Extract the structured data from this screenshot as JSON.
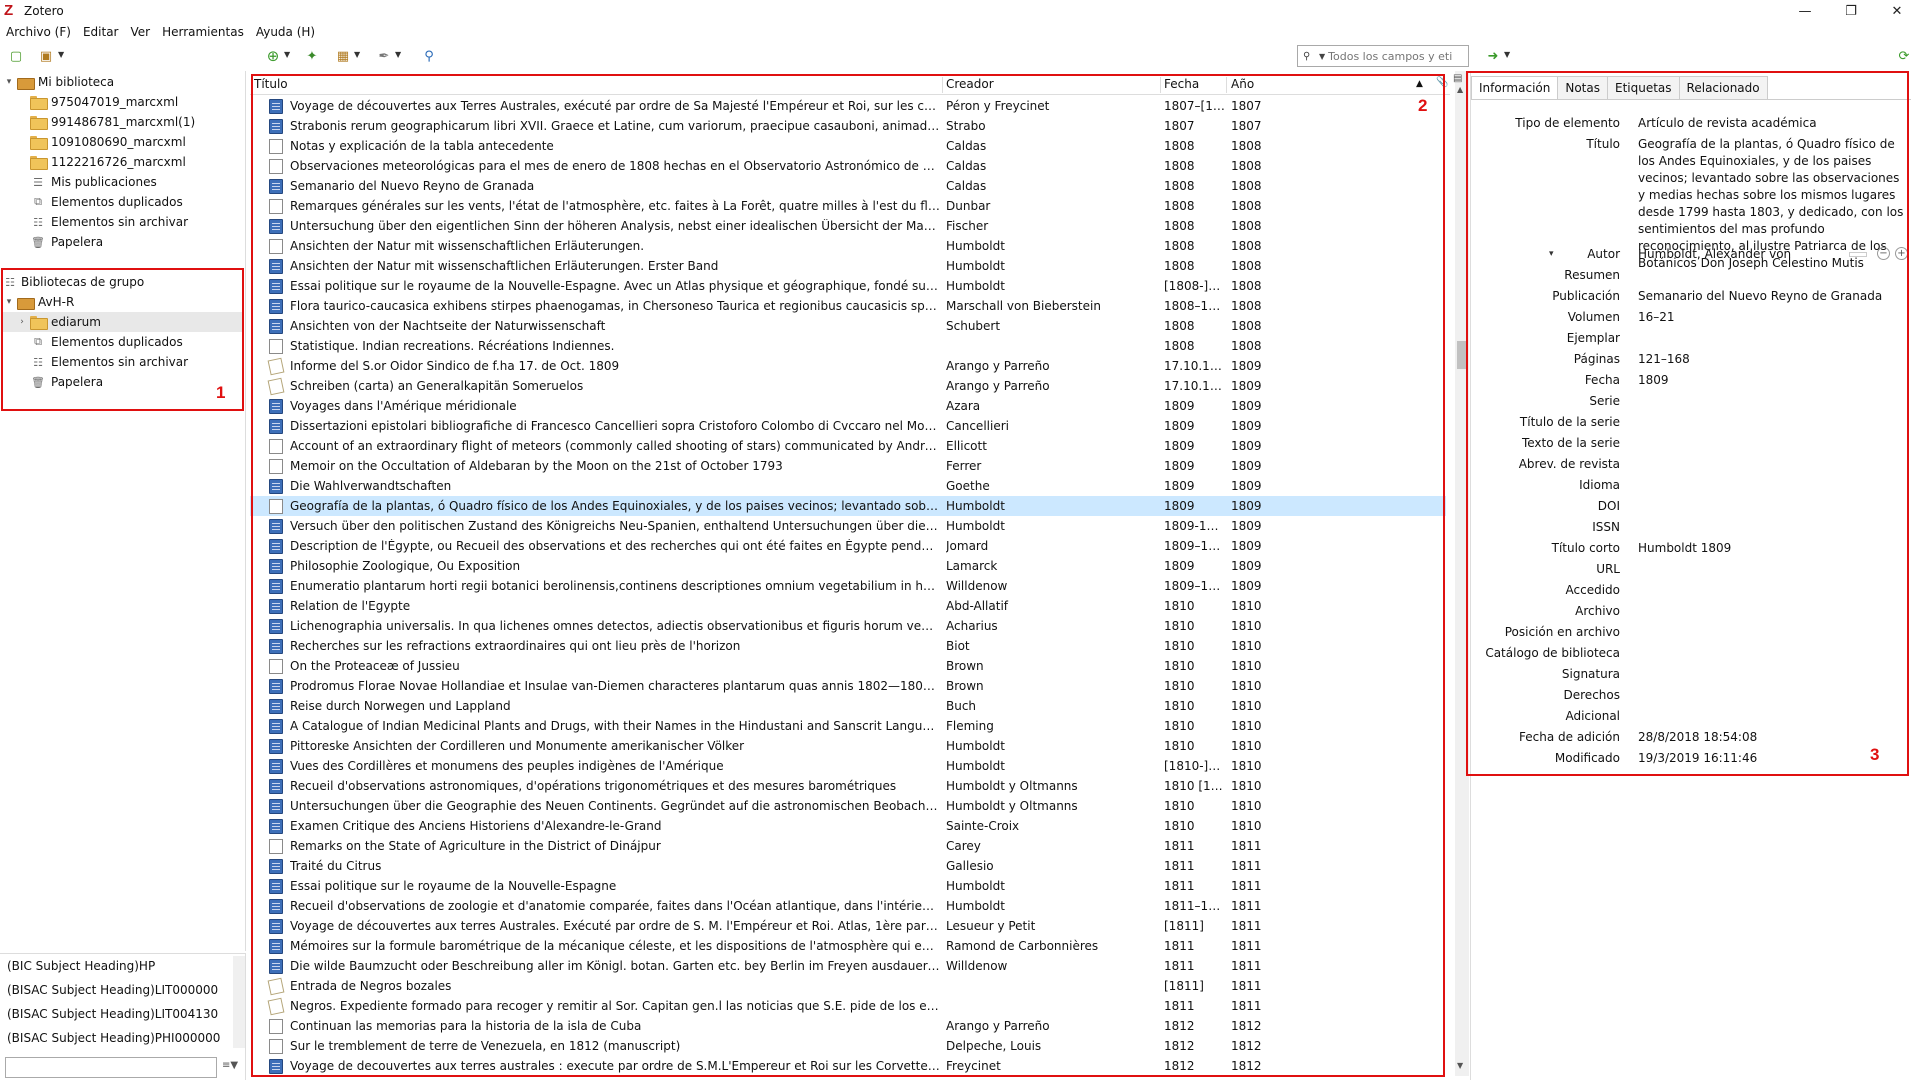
{
  "window": {
    "title": "Zotero"
  },
  "menu": [
    "Archivo (F)",
    "Editar",
    "Ver",
    "Herramientas",
    "Ayuda (H)"
  ],
  "search": {
    "placeholder": "Todos los campos y eti"
  },
  "collections": {
    "my_library": "Mi biblioteca",
    "my_library_items": [
      "975047019_marcxml",
      "991486781_marcxml(1)",
      "1091080690_marcxml",
      "1122216726_marcxml"
    ],
    "my_publications": "Mis publicaciones",
    "duplicates": "Elementos duplicados",
    "unfiled": "Elementos sin archivar",
    "trash": "Papelera",
    "group_libraries": "Bibliotecas de grupo",
    "group_name": "AvH-R",
    "group_collection": "ediarum",
    "group_duplicates": "Elementos duplicados",
    "group_unfiled": "Elementos sin archivar",
    "group_trash": "Papelera"
  },
  "tags": [
    "(BIC Subject Heading)HP",
    "(BISAC Subject Heading)LIT000000",
    "(BISAC Subject Heading)LIT004130",
    "(BISAC Subject Heading)PHI000000"
  ],
  "items_columns": {
    "title": "Título",
    "creator": "Creador",
    "date": "Fecha",
    "year": "Año"
  },
  "items": [
    {
      "type": "journal",
      "title": "Voyage de découvertes aux Terres Australes, exécuté par ordre de Sa Majesté l'Empéreur et Roi, sur les corvettes le Géogra...",
      "creator": "Péron y Freycinet",
      "date": "1807–[181...",
      "year": "1807"
    },
    {
      "type": "journal",
      "title": "Strabonis rerum geographicarum libri XVII. Graece et Latine, cum variorum, praecipue casaubonі, animadversionibus, juxt...",
      "creator": "Strabo",
      "date": "1807",
      "year": "1807"
    },
    {
      "type": "doc",
      "title": "Notas y explicación de la tabla antecedente",
      "creator": "Caldas",
      "date": "1808",
      "year": "1808"
    },
    {
      "type": "doc",
      "title": "Observaciones meteorológicas para el mes de enero de 1808 hechas en el Observatorio Astronómico de Santafé de Bogot...",
      "creator": "Caldas",
      "date": "1808",
      "year": "1808"
    },
    {
      "type": "journal",
      "title": "Semanario del Nuevo Reyno de Granada",
      "creator": "Caldas",
      "date": "1808",
      "year": "1808"
    },
    {
      "type": "doc",
      "title": "Remarques générales sur les vents, l'état de l'atmosphère, etc. faites à La Forêt, quatre milles à l'est du fleuve Mississipi ...",
      "creator": "Dunbar",
      "date": "1808",
      "year": "1808"
    },
    {
      "type": "journal",
      "title": "Untersuchung über den eigentlichen Sinn der höheren Analysis, nebst einer idealischen Übersicht der Mathematik und Na...",
      "creator": "Fischer",
      "date": "1808",
      "year": "1808"
    },
    {
      "type": "doc",
      "title": "Ansichten der Natur mit wissenschaftlichen Erläuterungen.",
      "creator": "Humboldt",
      "date": "1808",
      "year": "1808"
    },
    {
      "type": "journal",
      "title": "Ansichten der Natur mit wissenschaftlichen Erläuterungen. Erster Band",
      "creator": "Humboldt",
      "date": "1808",
      "year": "1808"
    },
    {
      "type": "journal",
      "title": "Essai politique sur le royaume de la Nouvelle-Espagne. Avec un Atlas physique et géographique, fondé sur des observatio...",
      "creator": "Humboldt",
      "date": "[1808-]1811",
      "year": "1808"
    },
    {
      "type": "journal",
      "title": "Flora taurico-caucasica exhibens stirpes phaenogamas, in Chersoneso Taurica et regionibus caucasicis sponte crescentes",
      "creator": "Marschall von Bieberstein",
      "date": "1808–1819",
      "year": "1808"
    },
    {
      "type": "journal",
      "title": "Ansichten von der Nachtseite der Naturwissenschaft",
      "creator": "Schubert",
      "date": "1808",
      "year": "1808"
    },
    {
      "type": "doc",
      "title": "Statistique. Indian recreations. Récréations Indiennes.",
      "creator": "",
      "date": "1808",
      "year": "1808"
    },
    {
      "type": "manuscript",
      "title": "Informe del S.or Oidor Sindico de f.ha 17. de Oct. 1809",
      "creator": "Arango y Parreño",
      "date": "17.10.1809",
      "year": "1809"
    },
    {
      "type": "manuscript",
      "title": "Schreiben (carta) an Generalkapitän Someruelos",
      "creator": "Arango y Parreño",
      "date": "17.10.1809",
      "year": "1809"
    },
    {
      "type": "journal",
      "title": "Voyages dans l'Amérique méridionale",
      "creator": "Azara",
      "date": "1809",
      "year": "1809"
    },
    {
      "type": "journal",
      "title": "Dissertazioni epistolari bibliografiche di Francesco Cancellieri sopra Cristoforo Colombo di Cvccaro nel Monferrato, disco...",
      "creator": "Cancellieri",
      "date": "1809",
      "year": "1809"
    },
    {
      "type": "doc",
      "title": "Account of an extraordinary flight of meteors (commonly called shooting of stars) communicated by Andrew Ellicot, Esq....",
      "creator": "Ellicott",
      "date": "1809",
      "year": "1809"
    },
    {
      "type": "doc",
      "title": "Memoir on the Occultation of Aldebaran by the Moon on the 21st of October 1793",
      "creator": "Ferrer",
      "date": "1809",
      "year": "1809"
    },
    {
      "type": "journal",
      "title": "Die Wahlverwandtschaften",
      "creator": "Goethe",
      "date": "1809",
      "year": "1809"
    },
    {
      "type": "doc",
      "title": "Geografía de la plantas, ó Quadro físico de los Andes Equinoxiales, y de los paises vecinos; levantado sobre las observacio...",
      "creator": "Humboldt",
      "date": "1809",
      "year": "1809",
      "selected": true
    },
    {
      "type": "journal",
      "title": "Versuch über den politischen Zustand des Königreichs Neu-Spanien, enthaltend Untersuchungen über die Geographie de...",
      "creator": "Humboldt",
      "date": "1809-1814",
      "year": "1809"
    },
    {
      "type": "journal",
      "title": "Description de l'Égypte, ou Recueil des observations et des recherches qui ont été faites en Égypte pendant l'expédition d...",
      "creator": "Jomard",
      "date": "1809–1818",
      "year": "1809"
    },
    {
      "type": "journal",
      "title": "Philosophie Zoologique, Ou Exposition",
      "creator": "Lamarck",
      "date": "1809",
      "year": "1809"
    },
    {
      "type": "journal",
      "title": "Enumeratio plantarum horti regii botanici berolinensis,continens descriptiones omnium vegetabilium in horto dicto culto...",
      "creator": "Willdenow",
      "date": "1809–1813",
      "year": "1809"
    },
    {
      "type": "journal",
      "title": "Relation de l'Egypte",
      "creator": "Abd-Allatif",
      "date": "1810",
      "year": "1810"
    },
    {
      "type": "journal",
      "title": "Lichenographia universalis. In qua lichenes omnes detectos, adiectis observationibus et figuris horum vegetabilium natur...",
      "creator": "Acharius",
      "date": "1810",
      "year": "1810"
    },
    {
      "type": "journal",
      "title": "Recherches sur les refractions extraordinaires qui ont lieu près de l'horizon",
      "creator": "Biot",
      "date": "1810",
      "year": "1810"
    },
    {
      "type": "doc",
      "title": "On the Proteaceæ of Jussieu",
      "creator": "Brown",
      "date": "1810",
      "year": "1810"
    },
    {
      "type": "journal",
      "title": "Prodromus Florae Novae Hollandiae et Insulae van-Diemen characteres plantarum quas annis 1802—1805 per oras utriusq...",
      "creator": "Brown",
      "date": "1810",
      "year": "1810"
    },
    {
      "type": "journal",
      "title": "Reise durch Norwegen und Lappland",
      "creator": "Buch",
      "date": "1810",
      "year": "1810"
    },
    {
      "type": "journal",
      "title": "A Catalogue of Indian Medicinal Plants and Drugs, with their Names in the Hindustani and Sanscrit Languages",
      "creator": "Fleming",
      "date": "1810",
      "year": "1810"
    },
    {
      "type": "journal",
      "title": "Pittoreske Ansichten der Cordilleren und Monumente amerikanischer Völker",
      "creator": "Humboldt",
      "date": "1810",
      "year": "1810"
    },
    {
      "type": "journal",
      "title": "Vues des Cordillères et monumens des peuples indigènes de l'Amérique",
      "creator": "Humboldt",
      "date": "[1810-]1813",
      "year": "1810"
    },
    {
      "type": "journal",
      "title": "Recueil d'observations astronomiques, d'opérations trigonométriques et des mesures barométriques",
      "creator": "Humboldt y Oltmanns",
      "date": "1810 [180...",
      "year": "1810"
    },
    {
      "type": "journal",
      "title": "Untersuchungen über die Geographie des Neuen Continents. Gegründet auf die astronomischen Beobachtungen und bar...",
      "creator": "Humboldt y Oltmanns",
      "date": "1810",
      "year": "1810"
    },
    {
      "type": "journal",
      "title": "Examen Critique des Anciens Historiens d'Alexandre-le-Grand",
      "creator": "Sainte-Croix",
      "date": "1810",
      "year": "1810"
    },
    {
      "type": "doc",
      "title": "Remarks on the State of Agriculture in the District of Dinájpur",
      "creator": "Carey",
      "date": "1811",
      "year": "1811"
    },
    {
      "type": "journal",
      "title": "Traité du Citrus",
      "creator": "Gallesio",
      "date": "1811",
      "year": "1811"
    },
    {
      "type": "journal",
      "title": "Essai politique sur le royaume de la Nouvelle-Espagne",
      "creator": "Humboldt",
      "date": "1811",
      "year": "1811"
    },
    {
      "type": "journal",
      "title": "Recueil d'observations de zoologie et d'anatomie comparée, faites dans l'Océan atlantique, dans l'intérieur du Nouveau C...",
      "creator": "Humboldt",
      "date": "1811–1833",
      "year": "1811"
    },
    {
      "type": "journal",
      "title": "Voyage de découvertes aux terres Australes. Exécuté par ordre de S. M. l'Empéreur et Roi. Atlas, 1ère partie",
      "creator": "Lesueur y Petit",
      "date": "[1811]",
      "year": "1811"
    },
    {
      "type": "journal",
      "title": "Mémoires sur la formule barométrique de la mécanique céleste, et les dispositions de l'atmosphère qui en modifient les p...",
      "creator": "Ramond de Carbonnières",
      "date": "1811",
      "year": "1811"
    },
    {
      "type": "journal",
      "title": "Die wilde Baumzucht oder Beschreibung aller im Königl. botan. Garten etc. bey Berlin im Freyen ausdauernden Bäume un...",
      "creator": "Willdenow",
      "date": "1811",
      "year": "1811"
    },
    {
      "type": "manuscript",
      "title": "Entrada de Negros bozales",
      "creator": "",
      "date": "[1811]",
      "year": "1811"
    },
    {
      "type": "manuscript",
      "title": "Negros. Expediente formado para recoger y remitir al Sor. Capitan gen.l las noticias que S.E. pide de los esclavos que han ...",
      "creator": "",
      "date": "1811",
      "year": "1811"
    },
    {
      "type": "doc",
      "title": "Continuan las memorias para la historia de la isla de Cuba",
      "creator": "Arango y Parreño",
      "date": "1812",
      "year": "1812"
    },
    {
      "type": "doc",
      "title": "Sur le tremblement de terre de Venezuela, en 1812 (manuscript)",
      "creator": "Delpeche, Louis",
      "date": "1812",
      "year": "1812"
    },
    {
      "type": "journal",
      "title": "Voyage de decouvertes aux terres australes : execute par ordre de S.M.L'Empereur et Roi sur les Corvettes le Geographe, le...",
      "creator": "Freycinet",
      "date": "1812",
      "year": "1812"
    }
  ],
  "item_pane": {
    "tabs": [
      "Información",
      "Notas",
      "Etiquetas",
      "Relacionado"
    ],
    "fields": [
      {
        "label": "Tipo de elemento",
        "value": "Artículo de revista académica"
      },
      {
        "label": "Título",
        "value": "Geografía de la plantas, ó Quadro físico de los Andes Equinoxiales, y de los paises vecinos; levantado sobre las observaciones y medias hechas sobre los mismos lugares desde 1799 hasta 1803, y dedicado, con los sentimientos del mas profundo reconocimiento, al ilustre Patriarca de los Botánicos Don Joseph Celestino Mutis"
      },
      {
        "label": "Autor",
        "value": "Humboldt, Alexander von"
      },
      {
        "label": "Resumen",
        "value": ""
      },
      {
        "label": "Publicación",
        "value": "Semanario del Nuevo Reyno de Granada"
      },
      {
        "label": "Volumen",
        "value": "16–21"
      },
      {
        "label": "Ejemplar",
        "value": ""
      },
      {
        "label": "Páginas",
        "value": "121–168"
      },
      {
        "label": "Fecha",
        "value": "1809"
      },
      {
        "label": "Serie",
        "value": ""
      },
      {
        "label": "Título de la serie",
        "value": ""
      },
      {
        "label": "Texto de la serie",
        "value": ""
      },
      {
        "label": "Abrev. de revista",
        "value": ""
      },
      {
        "label": "Idioma",
        "value": ""
      },
      {
        "label": "DOI",
        "value": ""
      },
      {
        "label": "ISSN",
        "value": ""
      },
      {
        "label": "Título corto",
        "value": "Humboldt 1809"
      },
      {
        "label": "URL",
        "value": ""
      },
      {
        "label": "Accedido",
        "value": ""
      },
      {
        "label": "Archivo",
        "value": ""
      },
      {
        "label": "Posición en archivo",
        "value": ""
      },
      {
        "label": "Catálogo de biblioteca",
        "value": ""
      },
      {
        "label": "Signatura",
        "value": ""
      },
      {
        "label": "Derechos",
        "value": ""
      },
      {
        "label": "Adicional",
        "value": ""
      },
      {
        "label": "Fecha de adición",
        "value": "28/8/2018 18:54:08"
      },
      {
        "label": "Modificado",
        "value": "19/3/2019 16:11:46"
      }
    ]
  },
  "annotations": [
    "1",
    "2",
    "3"
  ],
  "colors": {
    "annotation": "#e01010",
    "selection": "#cce8ff",
    "accent": "#c0141a"
  }
}
